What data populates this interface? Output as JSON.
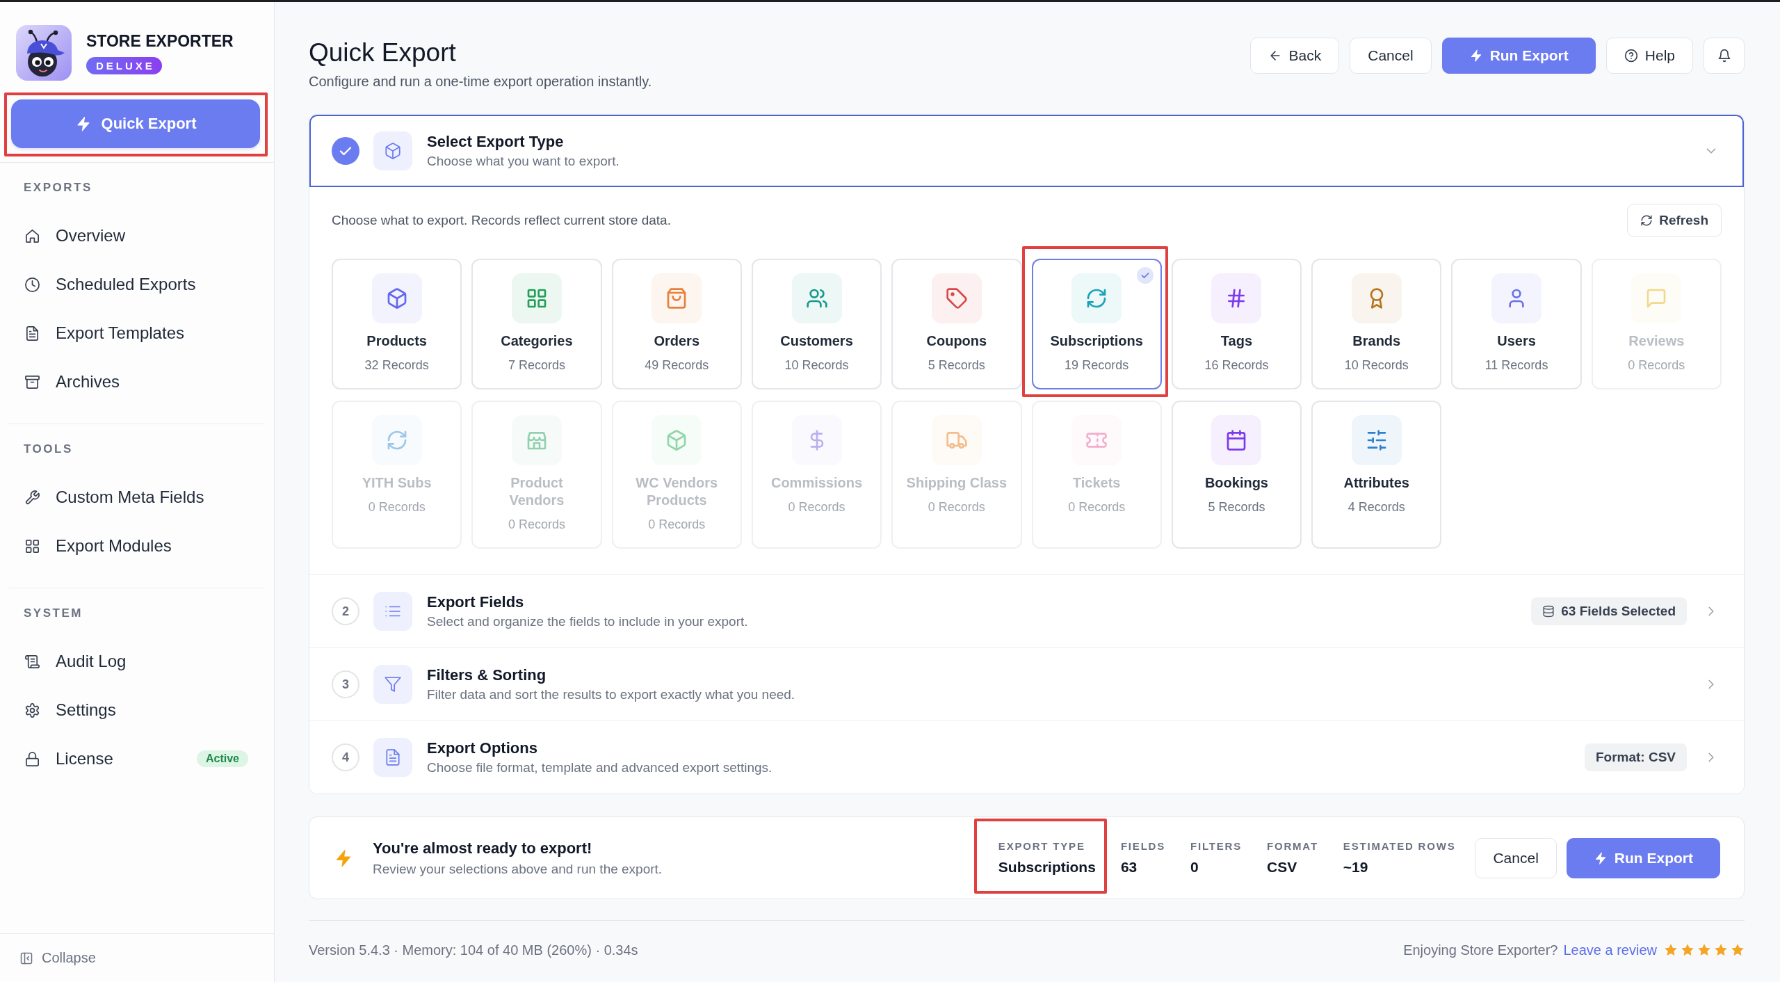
{
  "sidebar": {
    "brand": {
      "name": "STORE EXPORTER",
      "badge": "DELUXE"
    },
    "quick_export": {
      "label": "Quick Export",
      "highlighted": true
    },
    "sections": [
      {
        "heading": "EXPORTS",
        "items": [
          {
            "label": "Overview"
          },
          {
            "label": "Scheduled Exports"
          },
          {
            "label": "Export Templates"
          },
          {
            "label": "Archives"
          }
        ]
      },
      {
        "heading": "TOOLS",
        "items": [
          {
            "label": "Custom Meta Fields"
          },
          {
            "label": "Export Modules"
          }
        ]
      },
      {
        "heading": "SYSTEM",
        "items": [
          {
            "label": "Audit Log"
          },
          {
            "label": "Settings"
          },
          {
            "label": "License",
            "badge": "Active"
          }
        ]
      }
    ],
    "collapse": "Collapse"
  },
  "header": {
    "title": "Quick Export",
    "subtitle": "Configure and run a one-time export operation instantly.",
    "buttons": [
      {
        "kind": "outline",
        "label": "Back"
      },
      {
        "kind": "outline",
        "label": "Cancel"
      },
      {
        "kind": "primary",
        "label": "Run Export"
      },
      {
        "kind": "outline",
        "label": "Help"
      },
      {
        "kind": "icon"
      }
    ]
  },
  "steps": [
    {
      "title": "Select Export Type",
      "description": "Choose what you want to export.",
      "completed": true,
      "expanded": true,
      "content": {
        "hint": "Choose what to export. Records reflect current store data.",
        "refresh": "Refresh",
        "cards": [
          {
            "label": "Products",
            "records": "32 Records",
            "color": "#6366f1",
            "selected": false,
            "disabled": false,
            "highlighted": false
          },
          {
            "label": "Categories",
            "records": "7 Records",
            "color": "#22a05a",
            "selected": false,
            "disabled": false,
            "highlighted": false
          },
          {
            "label": "Orders",
            "records": "49 Records",
            "color": "#e8803a",
            "selected": false,
            "disabled": false,
            "highlighted": false
          },
          {
            "label": "Customers",
            "records": "10 Records",
            "color": "#14998a",
            "selected": false,
            "disabled": false,
            "highlighted": false
          },
          {
            "label": "Coupons",
            "records": "5 Records",
            "color": "#d94848",
            "selected": false,
            "disabled": false,
            "highlighted": false
          },
          {
            "label": "Subscriptions",
            "records": "19 Records",
            "color": "#1aa3b8",
            "selected": true,
            "disabled": false,
            "highlighted": true
          },
          {
            "label": "Tags",
            "records": "16 Records",
            "color": "#7c3aed",
            "selected": false,
            "disabled": false,
            "highlighted": false
          },
          {
            "label": "Brands",
            "records": "10 Records",
            "color": "#b7741f",
            "selected": false,
            "disabled": false,
            "highlighted": false
          },
          {
            "label": "Users",
            "records": "11 Records",
            "color": "#6b70e8",
            "selected": false,
            "disabled": false,
            "highlighted": false
          },
          {
            "label": "Reviews",
            "records": "0 Records",
            "color": "#f1d98c",
            "selected": false,
            "disabled": true,
            "highlighted": false
          },
          {
            "label": "YITH Subs",
            "records": "0 Records",
            "color": "#9cc7ea",
            "selected": false,
            "disabled": true,
            "highlighted": false
          },
          {
            "label": "Product Vendors",
            "records": "0 Records",
            "color": "#93d1ae",
            "selected": false,
            "disabled": true,
            "highlighted": false
          },
          {
            "label": "WC Vendors Products",
            "records": "0 Records",
            "color": "#8fd6a8",
            "selected": false,
            "disabled": true,
            "highlighted": false
          },
          {
            "label": "Commissions",
            "records": "0 Records",
            "color": "#b9b0f0",
            "selected": false,
            "disabled": true,
            "highlighted": false
          },
          {
            "label": "Shipping Class",
            "records": "0 Records",
            "color": "#f3bd8e",
            "selected": false,
            "disabled": true,
            "highlighted": false
          },
          {
            "label": "Tickets",
            "records": "0 Records",
            "color": "#f2aecb",
            "selected": false,
            "disabled": true,
            "highlighted": false
          },
          {
            "label": "Bookings",
            "records": "5 Records",
            "color": "#7c3aed",
            "selected": false,
            "disabled": false,
            "highlighted": false
          },
          {
            "label": "Attributes",
            "records": "4 Records",
            "color": "#2f80d0",
            "selected": false,
            "disabled": false,
            "highlighted": false
          }
        ]
      }
    },
    {
      "number": "2",
      "title": "Export Fields",
      "description": "Select and organize the fields to include in your export.",
      "completed": false,
      "expanded": false,
      "pill": {
        "kind": "count",
        "text": "63 Fields Selected"
      }
    },
    {
      "number": "3",
      "title": "Filters & Sorting",
      "description": "Filter data and sort the results to export exactly what you need.",
      "completed": false,
      "expanded": false
    },
    {
      "number": "4",
      "title": "Export Options",
      "description": "Choose file format, template and advanced export settings.",
      "completed": false,
      "expanded": false,
      "pill": {
        "kind": "format",
        "text": "Format: CSV"
      }
    }
  ],
  "summary": {
    "title": "You're almost ready to export!",
    "subtitle": "Review your selections above and run the export.",
    "items": [
      {
        "label": "EXPORT TYPE",
        "value": "Subscriptions",
        "highlighted": true
      },
      {
        "label": "FIELDS",
        "value": "63",
        "highlighted": false
      },
      {
        "label": "FILTERS",
        "value": "0",
        "highlighted": false
      },
      {
        "label": "FORMAT",
        "value": "CSV",
        "highlighted": false
      },
      {
        "label": "ESTIMATED ROWS",
        "value": "~19",
        "highlighted": false
      }
    ],
    "buttons": [
      {
        "kind": "outline",
        "label": "Cancel"
      },
      {
        "kind": "primary",
        "label": "Run Export"
      }
    ]
  },
  "footer": {
    "meta": "Version 5.4.3 · Memory: 104 of 40 MB (260%) · 0.34s",
    "prompt": "Enjoying Store Exporter?",
    "link": "Leave a review",
    "stars": 5
  }
}
